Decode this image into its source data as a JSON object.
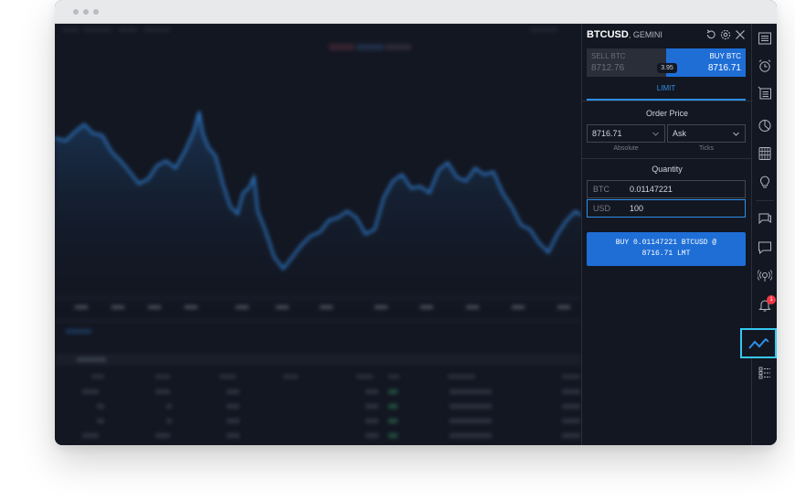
{
  "panel": {
    "symbol": "BTCUSD",
    "exchange": ", GEMINI",
    "sell_label": "SELL BTC",
    "sell_price": "8712.76",
    "buy_label": "BUY BTC",
    "buy_price": "8716.71",
    "spread": "3.95",
    "tab": "LIMIT",
    "order_price_title": "Order Price",
    "price_value": "8716.71",
    "price_type": "Ask",
    "absolute_label": "Absolute",
    "ticks_label": "Ticks",
    "quantity_title": "Quantity",
    "btc_label": "BTC",
    "btc_value": "0.01147221",
    "usd_label": "USD",
    "usd_value": "100",
    "submit_line1": "BUY 0.01147221 BTCUSD @",
    "submit_line2": "8716.71 LMT"
  },
  "rail": {
    "notification_count": "1"
  },
  "icons": {
    "header": [
      "reset-icon",
      "settings-icon",
      "close-icon"
    ],
    "rail": [
      "watchlist-icon",
      "alarm-clock-icon",
      "calendar-news-icon",
      "data-window-icon",
      "hotlist-icon",
      "ideas-icon",
      "chat-icon",
      "messages-icon",
      "streams-icon",
      "notifications-icon",
      "trading-panel-icon",
      "object-tree-icon"
    ]
  },
  "colors": {
    "accent": "#1e6ed6",
    "highlight": "#35c8f0",
    "background": "#131722",
    "badge": "#f23645"
  }
}
